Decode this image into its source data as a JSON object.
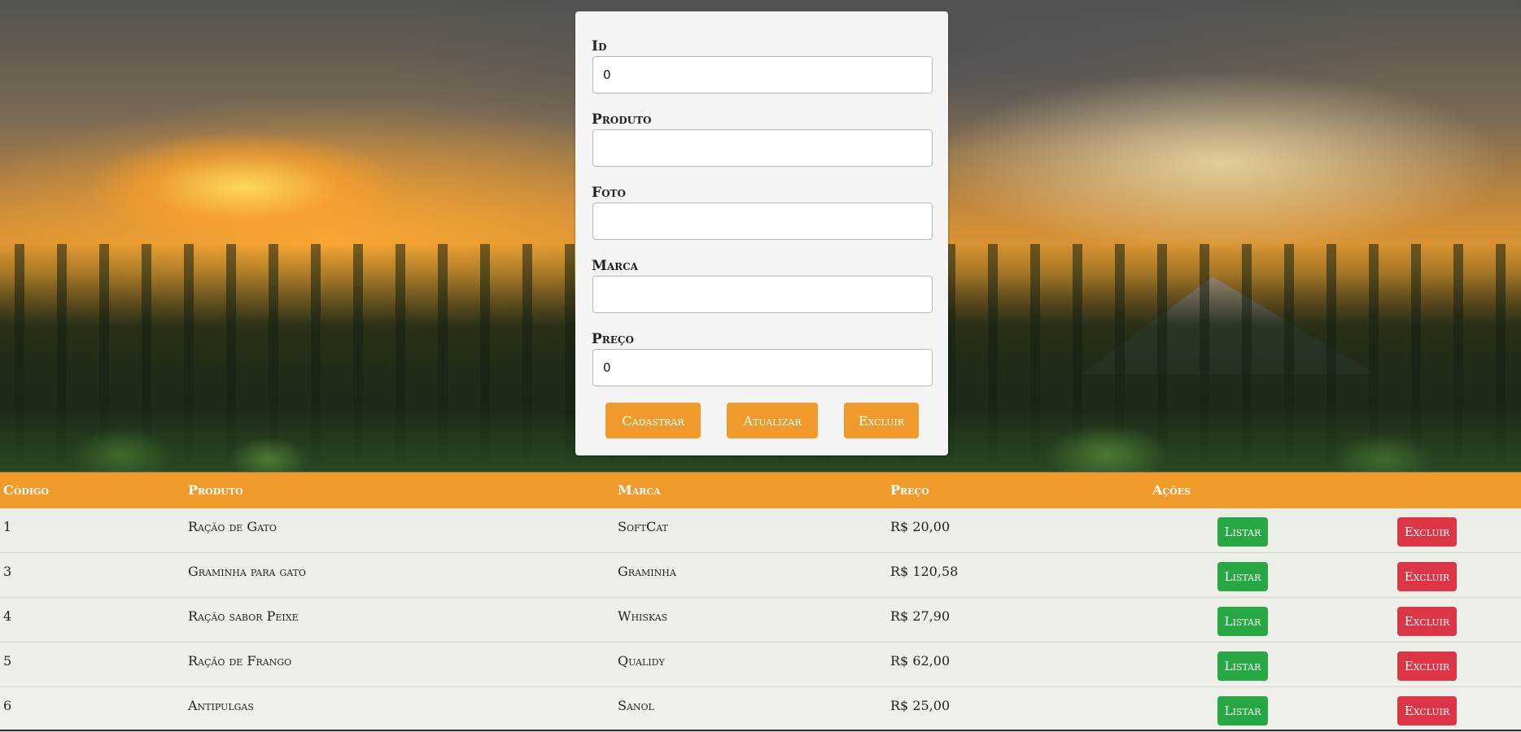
{
  "form": {
    "fields": [
      {
        "label": "Id",
        "value": "0"
      },
      {
        "label": "Produto",
        "value": ""
      },
      {
        "label": "Foto",
        "value": ""
      },
      {
        "label": "Marca",
        "value": ""
      },
      {
        "label": "Preço",
        "value": "0"
      }
    ],
    "buttons": {
      "cadastrar": "Cadastrar",
      "atualizar": "Atualizar",
      "excluir": "Excluir"
    }
  },
  "table": {
    "headers": {
      "codigo": "Código",
      "produto": "Produto",
      "marca": "Marca",
      "preco": "Preço",
      "acoes": "Ações"
    },
    "rows": [
      {
        "codigo": "1",
        "produto": "Ração de Gato",
        "marca": "SoftCat",
        "preco": "R$ 20,00",
        "listar": "Listar",
        "excluir": "Excluir"
      },
      {
        "codigo": "3",
        "produto": "Graminha para gato",
        "marca": "Graminha",
        "preco": "R$ 120,58",
        "listar": "Listar",
        "excluir": "Excluir"
      },
      {
        "codigo": "4",
        "produto": "Ração sabor Peixe",
        "marca": "Whiskas",
        "preco": "R$ 27,90",
        "listar": "Listar",
        "excluir": "Excluir"
      },
      {
        "codigo": "5",
        "produto": "Ração de Frango",
        "marca": "Qualidy",
        "preco": "R$ 62,00",
        "listar": "Listar",
        "excluir": "Excluir"
      },
      {
        "codigo": "6",
        "produto": "Antipulgas",
        "marca": "Sanol",
        "preco": "R$ 25,00",
        "listar": "Listar",
        "excluir": "Excluir"
      }
    ]
  },
  "colors": {
    "accent": "#ef9a2a",
    "listar": "#28a745",
    "excluir": "#dc3545"
  }
}
